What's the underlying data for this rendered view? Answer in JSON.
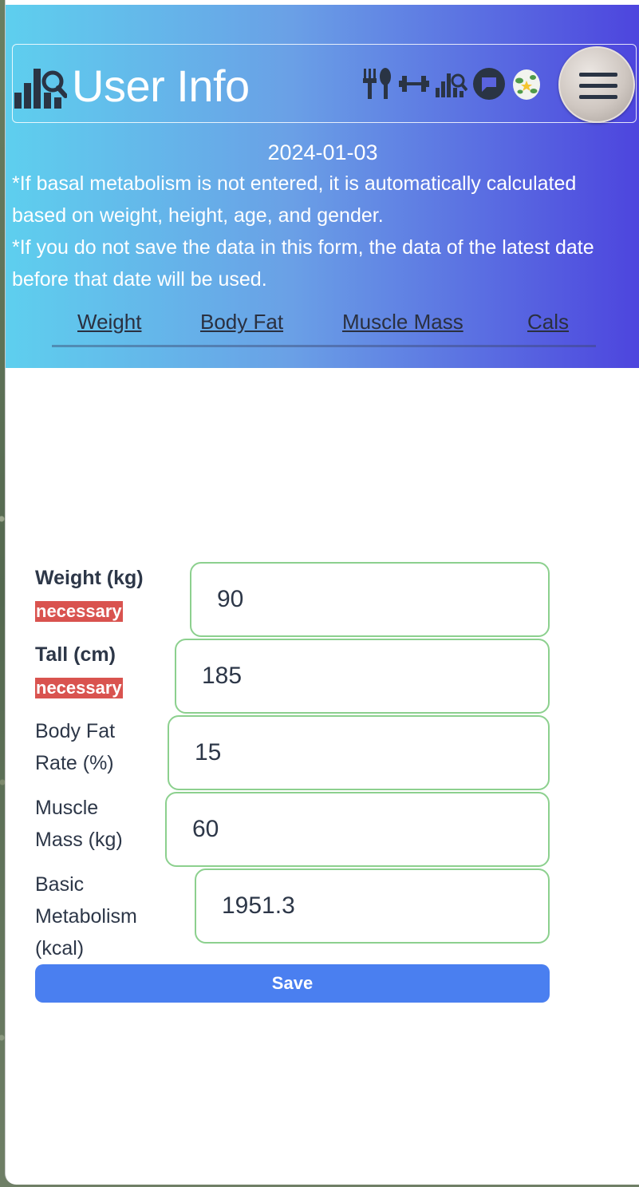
{
  "header": {
    "title": "User Info",
    "logo_icon": "chart-search-icon",
    "nav_icons": [
      "fork-knife-icon",
      "dumbbell-icon",
      "chart-search-icon",
      "chat-bubble-icon",
      "egg-icon"
    ],
    "menu_icon": "hamburger-menu-icon"
  },
  "date": "2024-01-03",
  "notes": [
    "*If basal metabolism is not entered, it is automatically calculated based on weight, height, age, and gender.",
    "*If you do not save the data in this form, the data of the latest date before that date will be used."
  ],
  "tabs": [
    {
      "label": "Weight"
    },
    {
      "label": "Body Fat"
    },
    {
      "label": "Muscle Mass"
    },
    {
      "label": "Cals"
    }
  ],
  "form": {
    "required_badge": "necessary",
    "fields": [
      {
        "label": "Weight (kg)",
        "value": "90",
        "required": true
      },
      {
        "label": "Tall (cm)",
        "value": "185",
        "required": true
      },
      {
        "label_lines": [
          "Body Fat",
          "Rate (%)"
        ],
        "value": "15",
        "required": false
      },
      {
        "label_lines": [
          "Muscle",
          "Mass (kg)"
        ],
        "value": "60",
        "required": false
      },
      {
        "label_lines": [
          "Basic",
          "Metabolism",
          "(kcal)"
        ],
        "value": "1951.3",
        "required": false
      }
    ],
    "save_label": "Save"
  },
  "colors": {
    "header_gradient_start": "#5ecfee",
    "header_gradient_end": "#4d45de",
    "badge": "#d9534f",
    "input_border": "#8cd08e",
    "save_button": "#4a7ff0",
    "text_dark": "#2d3748"
  }
}
